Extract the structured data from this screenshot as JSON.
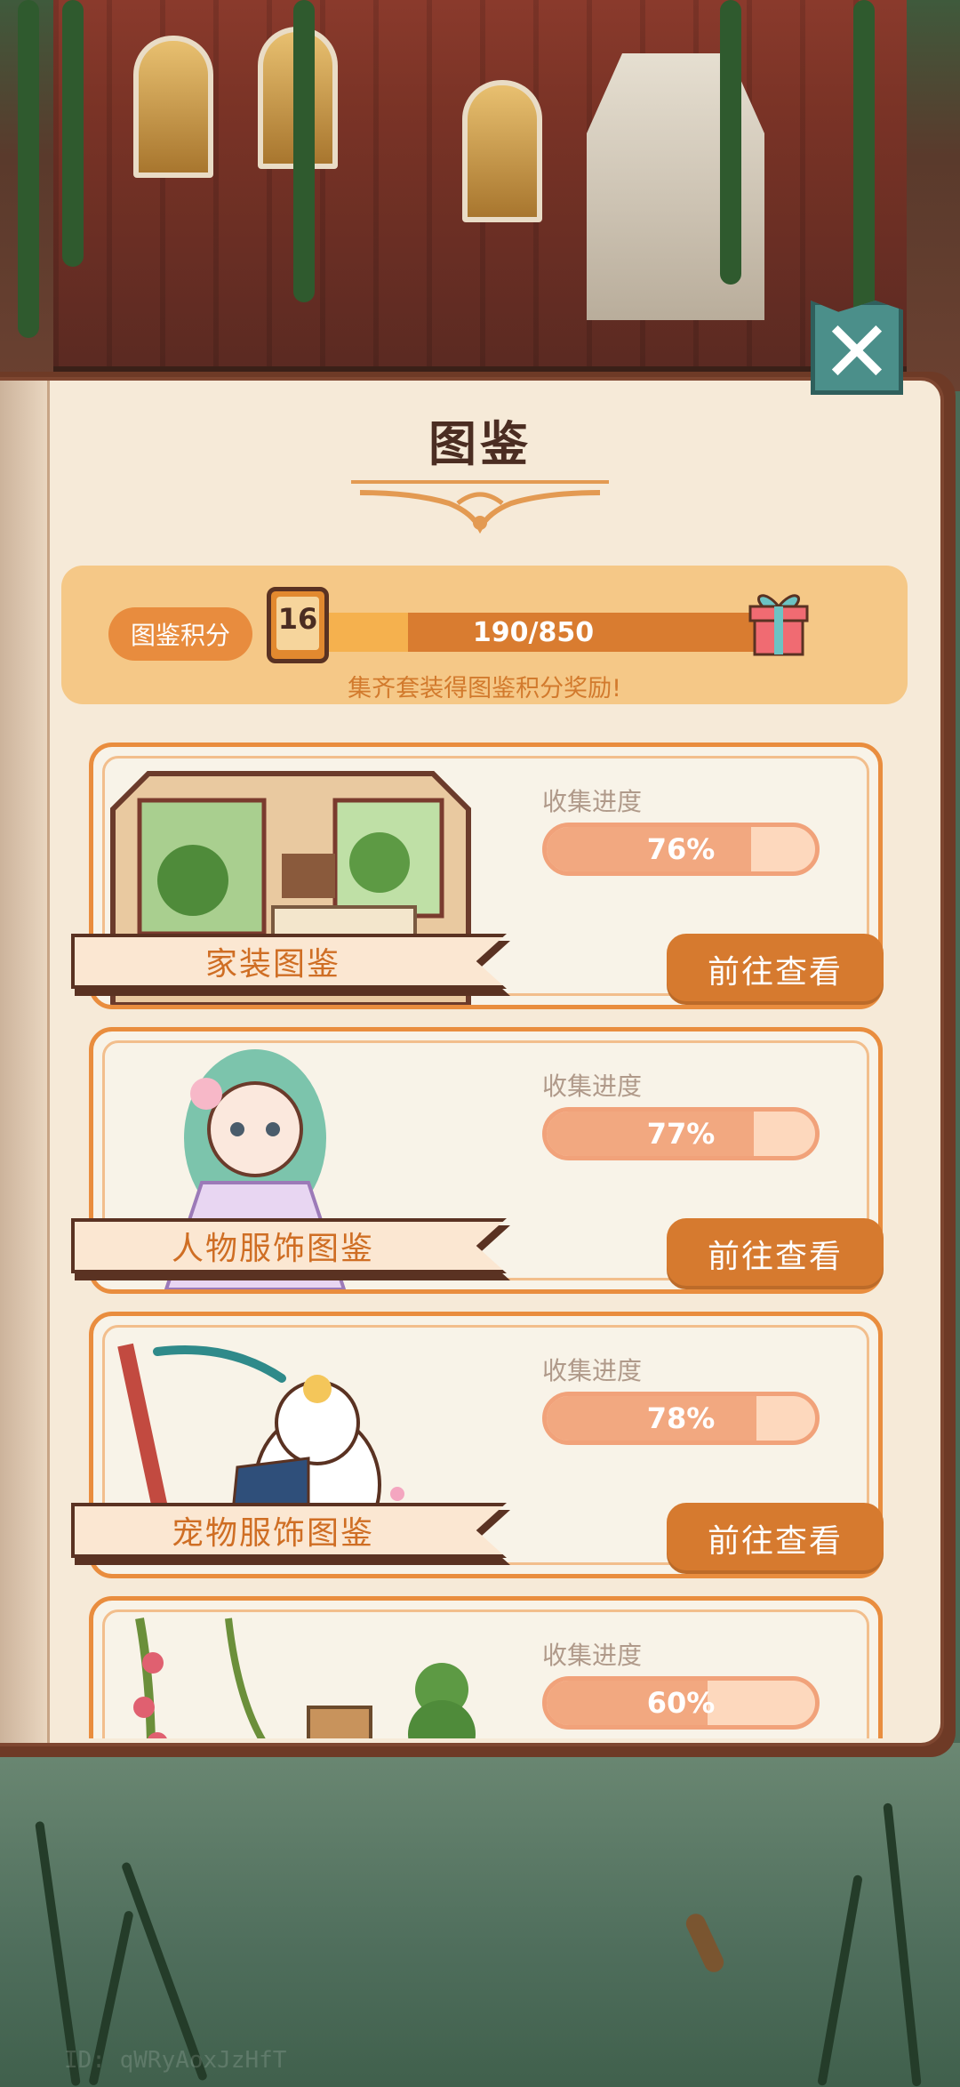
{
  "panel": {
    "title": "图鉴"
  },
  "score": {
    "label": "图鉴积分",
    "level": "16",
    "progress_text": "190/850",
    "current": 190,
    "total": 850,
    "hint": "集齐套装得图鉴积分奖励!"
  },
  "cards": [
    {
      "name": "家装图鉴",
      "progress_label": "收集进度",
      "percent_text": "76%",
      "percent": 0.76,
      "button": "前往查看"
    },
    {
      "name": "人物服饰图鉴",
      "progress_label": "收集进度",
      "percent_text": "77%",
      "percent": 0.77,
      "button": "前往查看"
    },
    {
      "name": "宠物服饰图鉴",
      "progress_label": "收集进度",
      "percent_text": "78%",
      "percent": 0.78,
      "button": "前往查看"
    },
    {
      "name": "",
      "progress_label": "收集进度",
      "percent_text": "60%",
      "percent": 0.6,
      "button": ""
    }
  ],
  "watermark": "ID: qWRyAoxJzHfT",
  "colors": {
    "accent_orange": "#d67a2f",
    "card_border": "#e98d3e",
    "title_brown": "#4b2d22",
    "close_teal": "#4b8f8a"
  },
  "icons": {
    "close": "close-x-icon",
    "gift": "gift-icon",
    "level_book": "book-badge-icon",
    "ornament": "title-ornament-icon"
  }
}
